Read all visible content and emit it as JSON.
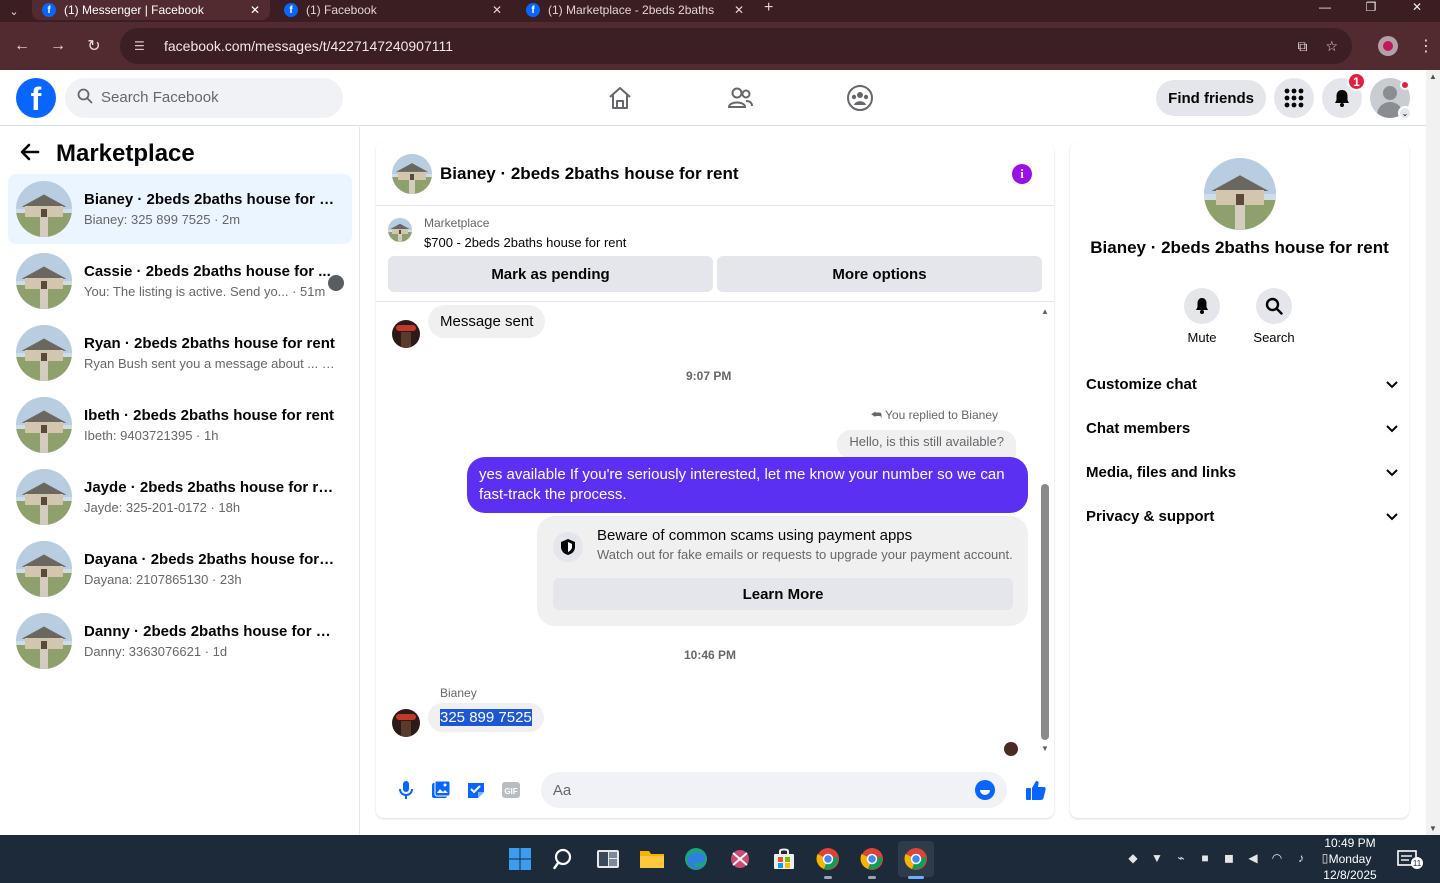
{
  "browser": {
    "tabs": [
      {
        "title": "(1) Messenger | Facebook",
        "active": true
      },
      {
        "title": "(1) Facebook",
        "active": false
      },
      {
        "title": "(1) Marketplace - 2beds 2baths",
        "active": false
      }
    ],
    "url": "facebook.com/messages/t/4227147240907111"
  },
  "fb_header": {
    "logo": "f",
    "search_placeholder": "Search Facebook",
    "find_friends_label": "Find friends",
    "notification_count": "1"
  },
  "sidebar": {
    "title": "Marketplace",
    "conversations": [
      {
        "name": "Bianey · 2beds 2baths house for re...",
        "preview": "Bianey: 325 899 7525 · 2m",
        "active": true
      },
      {
        "name": "Cassie · 2beds 2baths house for ...",
        "preview": "You: The listing is active. Send yo... · 51m",
        "active": false
      },
      {
        "name": "Ryan · 2beds 2baths house for rent",
        "preview": "Ryan Bush sent you a message about ... · 1h",
        "active": false
      },
      {
        "name": "Ibeth · 2beds 2baths house for rent",
        "preview": "Ibeth: 9403721395 · 1h",
        "active": false
      },
      {
        "name": "Jayde · 2beds 2baths house for rent",
        "preview": "Jayde: 325-201-0172 · 18h",
        "active": false
      },
      {
        "name": "Dayana · 2beds 2baths house for r...",
        "preview": "Dayana: 2107865130 · 23h",
        "active": false
      },
      {
        "name": "Danny · 2beds 2baths house for rent",
        "preview": "Danny: 3363076621 · 1d",
        "active": false
      }
    ]
  },
  "chat": {
    "title": "Bianey · 2beds 2baths house for rent",
    "info_glyph": "i",
    "marketplace_label": "Marketplace",
    "listing": "$700 - 2beds 2baths house for rent",
    "mark_pending_label": "Mark as pending",
    "more_options_label": "More options",
    "messages": {
      "message_sent": "Message sent",
      "time_1": "9:07 PM",
      "replied_to": "You replied to Bianey",
      "quoted": "Hello, is this still available?",
      "outgoing": "yes available If you're seriously interested, let me know your number so we can fast-track the process.",
      "scam_title": "Beware of common scams using payment apps",
      "scam_body": "Watch out for fake emails or requests to upgrade your payment account.",
      "learn_more": "Learn More",
      "time_2": "10:46 PM",
      "sender": "Bianey",
      "phone": "325 899 7525"
    },
    "composer_placeholder": "Aa"
  },
  "info_panel": {
    "name": "Bianey · 2beds 2baths house for rent",
    "actions": [
      {
        "label": "Mute"
      },
      {
        "label": "Search"
      }
    ],
    "sections": [
      "Customize chat",
      "Chat members",
      "Media, files and links",
      "Privacy & support"
    ]
  },
  "taskbar": {
    "time": "10:49 PM",
    "day": "Monday",
    "date": "12/8/2025",
    "notif_count": "11"
  },
  "colors": {
    "fb_blue": "#0866ff",
    "outgoing_bubble": "#5c30f3",
    "active_convo": "#ebf5ff",
    "info_purple": "#9b10e6",
    "chrome_bg": "#522b31"
  }
}
